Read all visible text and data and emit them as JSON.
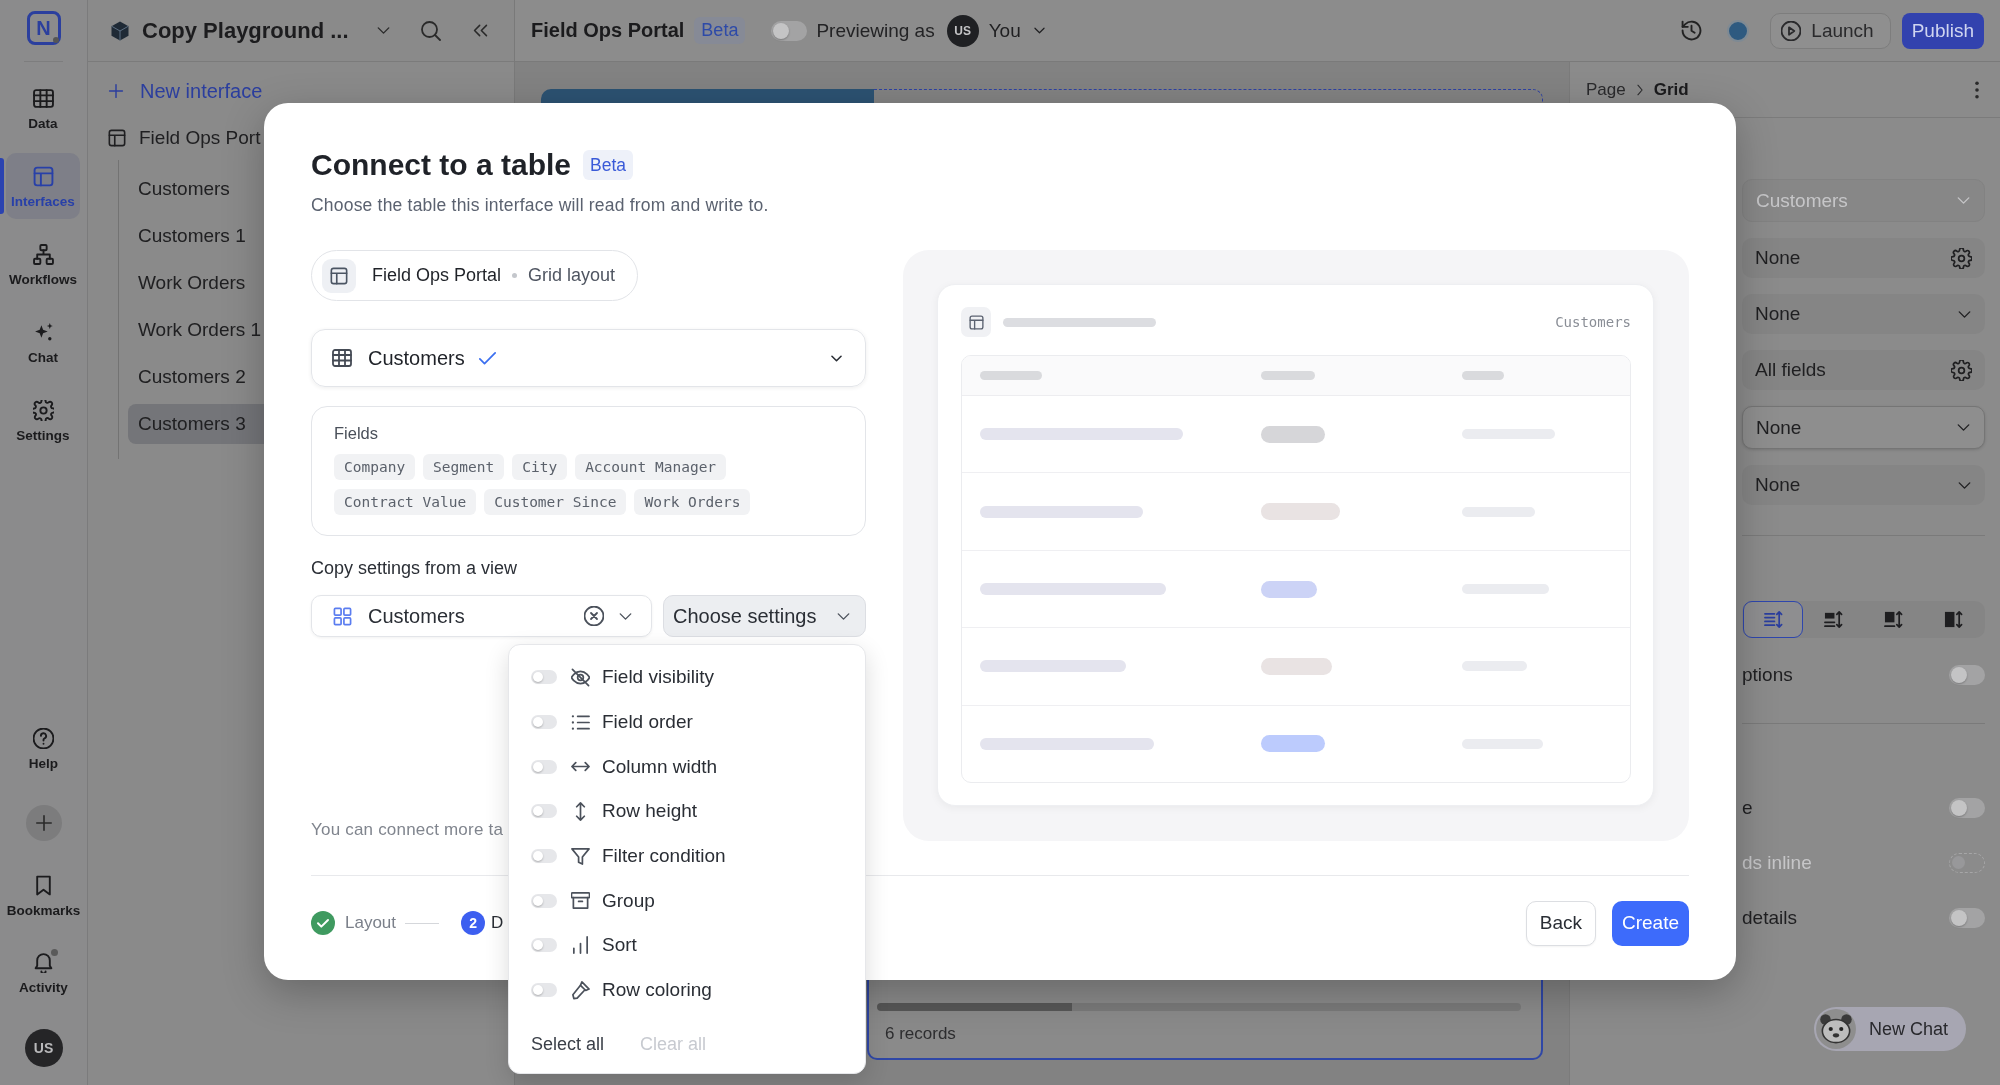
{
  "rail": {
    "logo": "N",
    "items": [
      {
        "label": "Data",
        "selected": false
      },
      {
        "label": "Interfaces",
        "selected": true
      },
      {
        "label": "Workflows",
        "selected": false
      },
      {
        "label": "Chat",
        "selected": false
      },
      {
        "label": "Settings",
        "selected": false
      }
    ],
    "bottom_items": [
      {
        "label": "Help",
        "unread": false
      },
      {
        "label": "Bookmarks",
        "unread": false
      },
      {
        "label": "Activity",
        "unread": true
      }
    ],
    "avatar": "US"
  },
  "sidebar": {
    "workspace": "Copy Playground ...",
    "new_button": "New interface",
    "tree": [
      {
        "label": "Field Ops Port",
        "selected": false,
        "children": [
          {
            "label": "Customers",
            "selected": false
          },
          {
            "label": "Customers 1",
            "selected": false
          },
          {
            "label": "Work Orders",
            "selected": false
          },
          {
            "label": "Work Orders 1",
            "selected": false
          },
          {
            "label": "Customers 2",
            "selected": false
          },
          {
            "label": "Customers 3",
            "selected": true
          }
        ]
      }
    ]
  },
  "topbar": {
    "title": "Field Ops Portal",
    "badge": "Beta",
    "preview_toggle": {
      "on": false
    },
    "preview_label": "Previewing as",
    "avatar": "US",
    "user": "You",
    "launch": "Launch",
    "publish": "Publish"
  },
  "canvas": {
    "records": "6 records"
  },
  "properties": {
    "breadcrumb": [
      "Page",
      "Grid"
    ],
    "fields": [
      {
        "kind": "select",
        "value": "Customers",
        "disabled": true
      },
      {
        "kind": "settings",
        "value": "None",
        "disabled": false
      },
      {
        "kind": "select",
        "value": "None",
        "disabled": false
      },
      {
        "kind": "settings",
        "value": "All fields",
        "disabled": false
      },
      {
        "kind": "outlined",
        "value": "None",
        "disabled": false
      },
      {
        "kind": "select",
        "value": "None",
        "disabled": false
      }
    ],
    "density": [
      {
        "selected": true
      },
      {
        "selected": false
      },
      {
        "selected": false
      },
      {
        "selected": false
      }
    ],
    "sections": [
      {
        "toggles": [
          {
            "label": "ptions",
            "on": false,
            "disabled": false
          }
        ]
      },
      {
        "toggles": [
          {
            "label": "e",
            "on": false,
            "disabled": false
          },
          {
            "label": "ds inline",
            "on": false,
            "disabled": true
          },
          {
            "label": "details",
            "on": false,
            "disabled": false
          }
        ]
      }
    ],
    "chat_button": "New Chat"
  },
  "modal": {
    "title": "Connect to a table",
    "badge": "Beta",
    "subtitle": "Choose the table this interface will read from and write to.",
    "source": {
      "name": "Field Ops Portal",
      "layout": "Grid layout"
    },
    "table_select": {
      "value": "Customers",
      "confirmed": true
    },
    "fields": {
      "label": "Fields",
      "items": [
        "Company",
        "Segment",
        "City",
        "Account Manager",
        "Contract Value",
        "Customer Since",
        "Work Orders"
      ]
    },
    "copy_label": "Copy settings from a view",
    "view_select": {
      "value": "Customers"
    },
    "settings_button": {
      "label": "Choose settings",
      "expanded": true
    },
    "settings_menu": {
      "options": [
        {
          "label": "Field visibility",
          "on": false
        },
        {
          "label": "Field order",
          "on": false
        },
        {
          "label": "Column width",
          "on": false
        },
        {
          "label": "Row height",
          "on": false
        },
        {
          "label": "Filter condition",
          "on": false
        },
        {
          "label": "Group",
          "on": false
        },
        {
          "label": "Sort",
          "on": false
        },
        {
          "label": "Row coloring",
          "on": false
        }
      ],
      "select_all": "Select all",
      "clear_all": {
        "label": "Clear all",
        "disabled": true
      }
    },
    "note": "You can connect more ta",
    "preview": {
      "table_name": "Customers",
      "rows": [
        {
          "color": "#d6d6d9"
        },
        {
          "color": "#e9e3e3"
        },
        {
          "color": "#ccd3f6"
        },
        {
          "color": "#e9e3e3"
        },
        {
          "color": "#bccbfd"
        }
      ]
    },
    "steps": [
      {
        "label": "Layout",
        "done": true
      },
      {
        "number": "2",
        "label": "D",
        "done": false
      }
    ],
    "back": "Back",
    "create": "Create"
  }
}
